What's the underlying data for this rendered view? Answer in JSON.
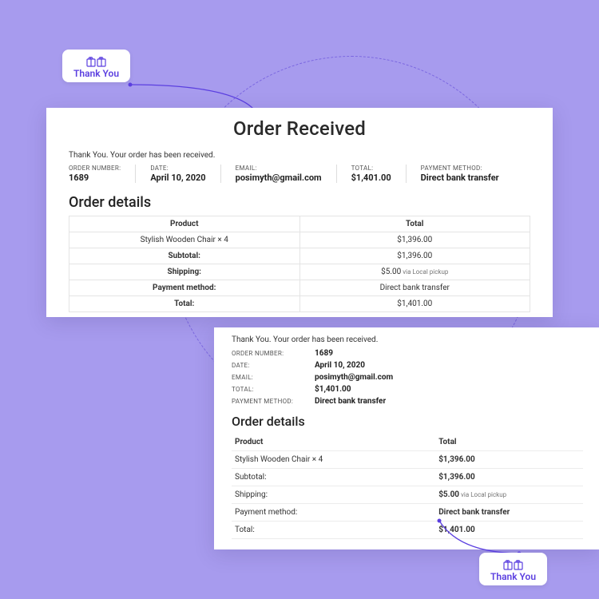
{
  "tag_label": "Thank You",
  "page_title": "Order Received",
  "thankyou_message": "Thank You. Your order has been received.",
  "meta": {
    "order_number": {
      "label": "ORDER NUMBER:",
      "value": "1689"
    },
    "date": {
      "label": "DATE:",
      "value": "April 10, 2020"
    },
    "email": {
      "label": "EMAIL:",
      "value": "posimyth@gmail.com"
    },
    "total": {
      "label": "TOTAL:",
      "value": "$1,401.00"
    },
    "payment": {
      "label": "PAYMENT METHOD:",
      "value": "Direct bank transfer"
    }
  },
  "details": {
    "heading": "Order details",
    "th_product": "Product",
    "th_total": "Total",
    "rows": {
      "item": {
        "label": "Stylish Wooden Chair × 4",
        "value": "$1,396.00"
      },
      "subtotal": {
        "label": "Subtotal:",
        "value": "$1,396.00"
      },
      "shipping": {
        "label": "Shipping:",
        "value": "$5.00",
        "suffix": "via Local pickup"
      },
      "payment": {
        "label": "Payment method:",
        "value": "Direct bank transfer"
      },
      "total": {
        "label": "Total:",
        "value": "$1,401.00"
      }
    }
  }
}
